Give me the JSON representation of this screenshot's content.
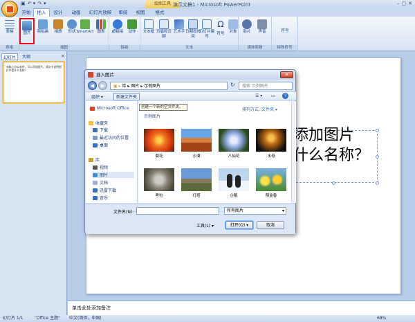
{
  "app": {
    "title": "演示文稿1 - Microsoft PowerPoint",
    "context_tab": "绘图工具"
  },
  "quick_access": {
    "save": "▣",
    "undo": "↶ ▾",
    "redo": "↷",
    "more": "▾"
  },
  "window_controls": {
    "min": "–",
    "max": "▢",
    "close": "✕"
  },
  "tabs": [
    {
      "label": "开始"
    },
    {
      "label": "插入"
    },
    {
      "label": "设计"
    },
    {
      "label": "动画"
    },
    {
      "label": "幻灯片放映"
    },
    {
      "label": "审阅"
    },
    {
      "label": "视图"
    },
    {
      "label": "格式"
    }
  ],
  "ribbon": {
    "groups": [
      {
        "label": "表格"
      },
      {
        "label": "插图"
      },
      {
        "label": "链接"
      },
      {
        "label": "文本"
      },
      {
        "label": "媒体剪辑"
      },
      {
        "label": "特殊符号"
      }
    ],
    "buttons": [
      "表格",
      "图片",
      "剪贴画",
      "相册",
      "形状",
      "SmartArt",
      "图表",
      "超链接",
      "动作",
      "文本框",
      "页眉和页脚",
      "艺术字",
      "日期和时间",
      "幻灯片编号",
      "符号",
      "对象",
      "影片",
      "声音",
      "符号"
    ]
  },
  "slide_panel": {
    "tabs": [
      "幻灯片",
      "大纲"
    ],
    "close": "×",
    "thumb_number": "1",
    "thumb_text": "电脑上办公软件，可以添加图片，请文字说明图片中是什么名称？"
  },
  "slide": {
    "text_line1": "添加图片",
    "text_line2": "什么名称？"
  },
  "notes": {
    "placeholder": "单击此处添加备注"
  },
  "status": {
    "slide": "幻灯片 1/1",
    "theme": "\"Office 主题\"",
    "lang": "中文(简体，中国)",
    "zoom": "68%"
  },
  "dialog": {
    "title": "插入图片",
    "close": "✕",
    "path": [
      "库",
      "图片",
      "示例图片"
    ],
    "search_placeholder": "搜索 示例图片",
    "toolbar": {
      "organize": "组织 ▾",
      "new_folder": "新建文件夹"
    },
    "tooltip": "创建一个新的空文件夹。",
    "nav": {
      "brand": "Microsoft Office",
      "favorites": "收藏夹",
      "items_fav": [
        "下载",
        "最近访问的位置",
        "桌面"
      ],
      "libraries": "库",
      "items_lib": [
        "视频",
        "图片",
        "文档",
        "迅雷下载",
        "音乐"
      ]
    },
    "library_title": "示例图片",
    "arrange": {
      "label": "排列方式:",
      "value": "文件夹 ▾"
    },
    "pictures": [
      {
        "name": "菊花",
        "color": "flower"
      },
      {
        "name": "沙漠",
        "color": "desert"
      },
      {
        "name": "八仙花",
        "color": "hydrangea"
      },
      {
        "name": "水母",
        "color": "jellyfish"
      },
      {
        "name": "考拉",
        "color": "koala"
      },
      {
        "name": "灯塔",
        "color": "lighthouse"
      },
      {
        "name": "企鹅",
        "color": "penguins"
      },
      {
        "name": "郁金香",
        "color": "tulips"
      }
    ],
    "filename_label": "文件名(N):",
    "filename_value": "",
    "filter": "所有图片",
    "tools": "工具(L) ▾",
    "open": "打开(O) ▾",
    "cancel": "取消"
  }
}
